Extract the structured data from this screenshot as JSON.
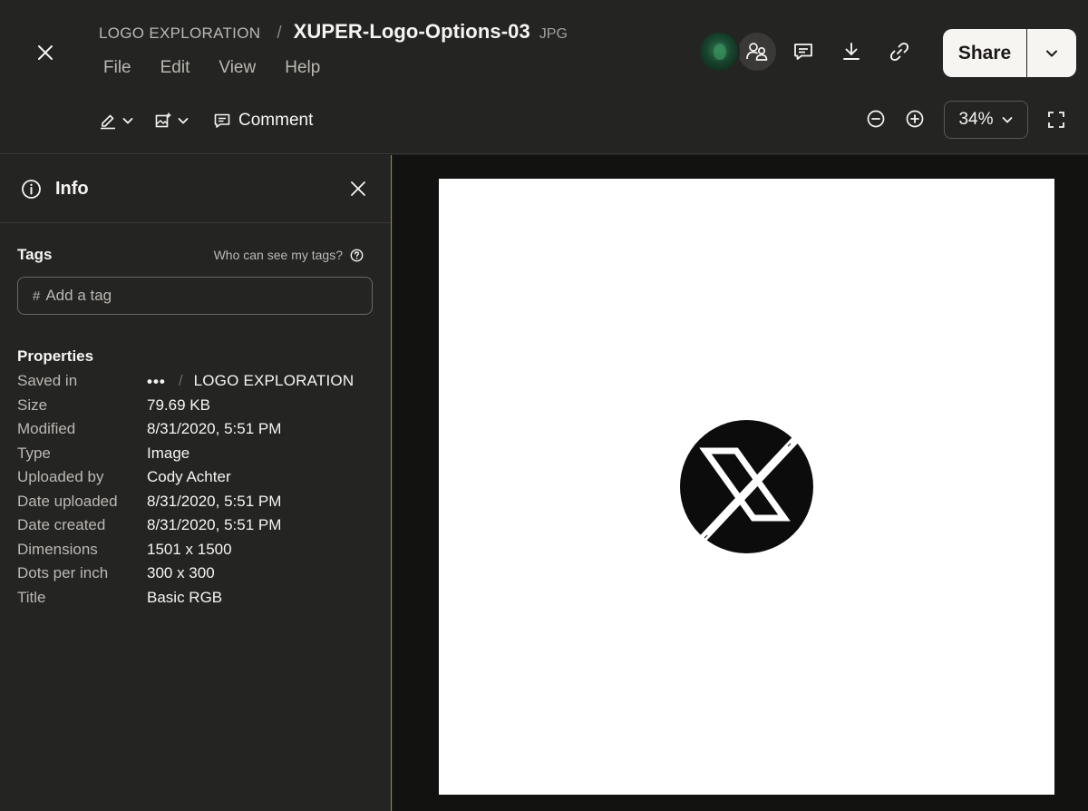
{
  "header": {
    "breadcrumb_folder": "LOGO EXPLORATION",
    "breadcrumb_separator": "/",
    "file_name": "XUPER-Logo-Options-03",
    "file_ext": "JPG",
    "menu": [
      "File",
      "Edit",
      "View",
      "Help"
    ],
    "toolbar": {
      "annotate_icon": "pen-icon",
      "image_tools_icon": "image-edit-icon",
      "comment_label": "Comment"
    },
    "share_label": "Share",
    "zoom_value": "34%"
  },
  "sidebar": {
    "title": "Info",
    "tags_label": "Tags",
    "tags_help": "Who can see my tags?",
    "tag_hash": "#",
    "tag_placeholder": "Add a tag",
    "properties_label": "Properties",
    "saved_in": {
      "key": "Saved in",
      "ellipsis": "•••",
      "separator": "/",
      "folder": "LOGO EXPLORATION"
    },
    "properties": [
      {
        "key": "Size",
        "value": "79.69 KB"
      },
      {
        "key": "Modified",
        "value": "8/31/2020, 5:51 PM"
      },
      {
        "key": "Type",
        "value": "Image"
      },
      {
        "key": "Uploaded by",
        "value": "Cody Achter"
      },
      {
        "key": "Date uploaded",
        "value": "8/31/2020, 5:51 PM"
      },
      {
        "key": "Date created",
        "value": "8/31/2020, 5:51 PM"
      },
      {
        "key": "Dimensions",
        "value": "1501 x 1500"
      },
      {
        "key": "Dots per inch",
        "value": "300 x 300"
      },
      {
        "key": "Title",
        "value": "Basic RGB"
      }
    ]
  },
  "colors": {
    "background": "#1e1e1d",
    "panel": "#242423",
    "text_primary": "#f7f5f2",
    "text_secondary": "#bbb8b2",
    "share_button": "#f7f5f2",
    "sidebar_divider_accent": "#a88a3c"
  }
}
